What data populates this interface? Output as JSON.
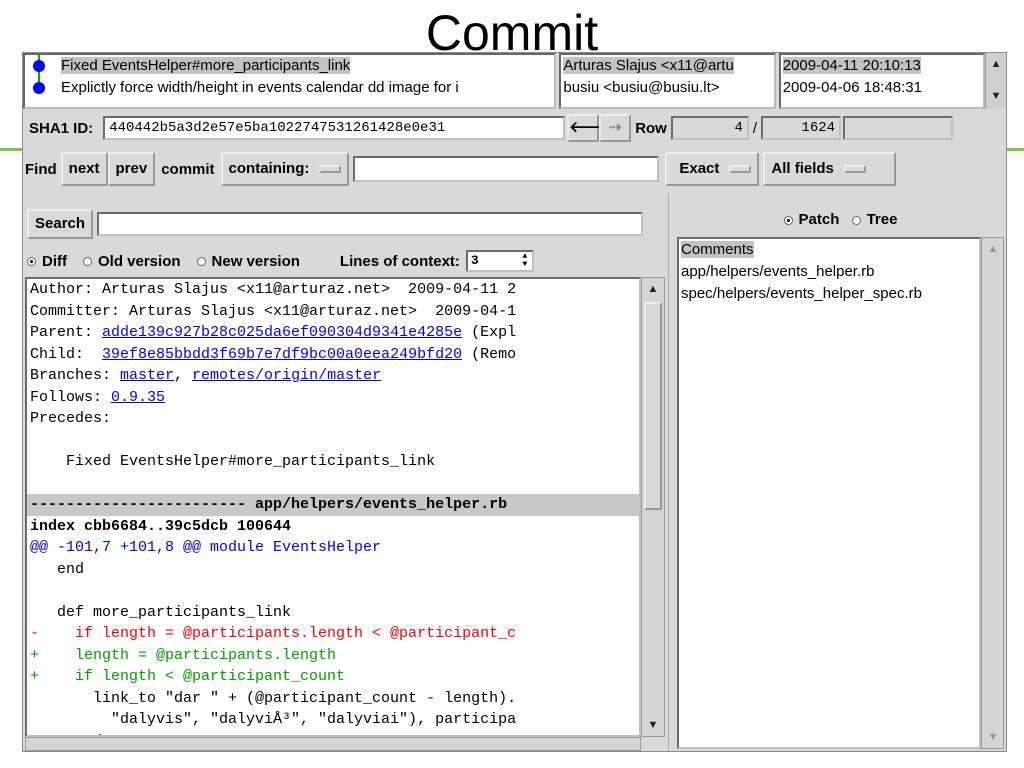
{
  "slide": {
    "title": "Commit"
  },
  "commits": [
    {
      "subject": "Fixed EventsHelper#more_participants_link",
      "author": "Arturas Slajus <x11@artu",
      "date": "2009-04-11 20:10:13",
      "selected": true
    },
    {
      "subject": "Explictly force width/height in events calendar dd image for i",
      "author": "busiu <busiu@busiu.lt>",
      "date": "2009-04-06 18:48:31",
      "selected": false
    }
  ],
  "sha_bar": {
    "label": "SHA1 ID:",
    "value": "440442b5a3d2e57e5ba1022747531261428e0e31",
    "row_label": "Row",
    "row_current": "4",
    "row_sep": "/",
    "row_total": "1624"
  },
  "find_bar": {
    "find_label": "Find",
    "next_label": "next",
    "prev_label": "prev",
    "commit_label": "commit",
    "containing_label": "containing:",
    "search_value": "",
    "exact_label": "Exact",
    "fields_label": "All fields"
  },
  "details": {
    "search_button": "Search",
    "diff_label": "Diff",
    "old_label": "Old version",
    "new_label": "New version",
    "context_label": "Lines of context:",
    "context_value": "3",
    "lines": [
      {
        "kind": "plain",
        "text": "Author: Arturas Slajus <x11@arturaz.net>  2009-04-11 2"
      },
      {
        "kind": "plain",
        "text": "Committer: Arturas Slajus <x11@arturaz.net>  2009-04-1"
      },
      {
        "kind": "link",
        "prefix": "Parent: ",
        "link": "adde139c927b28c025da6ef090304d9341e4285e",
        "suffix": " (Expl"
      },
      {
        "kind": "link",
        "prefix": "Child:  ",
        "link": "39ef8e85bbdd3f69b7e7df9bc00a0eea249bfd20",
        "suffix": " (Remo"
      },
      {
        "kind": "branches",
        "prefix": "Branches: ",
        "link1": "master",
        "mid": ", ",
        "link2": "remotes/origin/master"
      },
      {
        "kind": "link",
        "prefix": "Follows: ",
        "link": "0.9.35",
        "suffix": ""
      },
      {
        "kind": "plain",
        "text": "Precedes:"
      },
      {
        "kind": "plain",
        "text": ""
      },
      {
        "kind": "plain",
        "text": "    Fixed EventsHelper#more_participants_link"
      },
      {
        "kind": "plain",
        "text": ""
      },
      {
        "kind": "hdr",
        "text": "------------------------ app/helpers/events_helper.rb"
      },
      {
        "kind": "bold",
        "text": "index cbb6684..39c5dcb 100644"
      },
      {
        "kind": "hunk",
        "text": "@@ -101,7 +101,8 @@ module EventsHelper"
      },
      {
        "kind": "plain",
        "text": "   end"
      },
      {
        "kind": "plain",
        "text": ""
      },
      {
        "kind": "plain",
        "text": "   def more_participants_link"
      },
      {
        "kind": "del",
        "text": "-    if length = @participants.length < @participant_c"
      },
      {
        "kind": "add",
        "text": "+    length = @participants.length"
      },
      {
        "kind": "add",
        "text": "+    if length < @participant_count"
      },
      {
        "kind": "plain",
        "text": "       link_to \"dar \" + (@participant_count - length)."
      },
      {
        "kind": "plain",
        "text": "         \"dalyvis\", \"dalyviÅ³\", \"dalyviai\"), participa"
      },
      {
        "kind": "plain",
        "text": "     end"
      }
    ]
  },
  "file_panel": {
    "patch_label": "Patch",
    "tree_label": "Tree",
    "files": [
      {
        "name": "Comments",
        "selected": true
      },
      {
        "name": "app/helpers/events_helper.rb",
        "selected": false
      },
      {
        "name": "spec/helpers/events_helper_spec.rb",
        "selected": false
      }
    ]
  },
  "colors": {
    "accent_green": "#7ec242",
    "link_blue": "#0000ff",
    "removed_red": "#ff0000",
    "added_green": "#00a000",
    "node_blue": "#0000ff"
  }
}
